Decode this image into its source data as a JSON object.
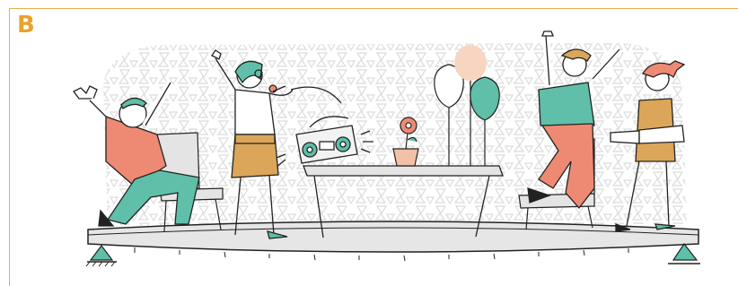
{
  "panel": {
    "label": "B"
  },
  "colors": {
    "accent": "#e8a32c",
    "teal": "#5fbfa8",
    "salmon": "#ee8a73",
    "mustard": "#dba65a",
    "peach": "#f7d5c0",
    "pattern": "#dcdcdc",
    "ink": "#222222",
    "chair": "#e4e4e4"
  },
  "icons": [
    "party-scene-illustration",
    "boombox-icon",
    "flower-pot-icon",
    "balloon-icon",
    "support-triangle-icon"
  ]
}
